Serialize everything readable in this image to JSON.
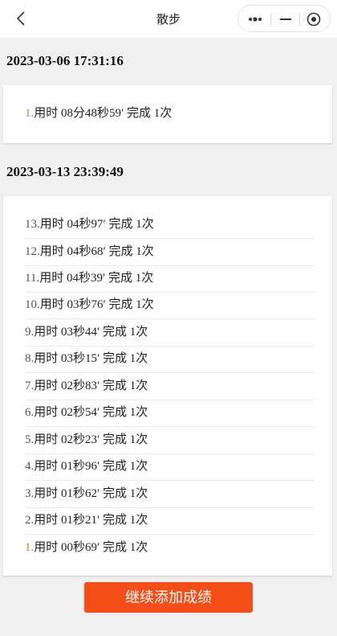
{
  "nav": {
    "title": "散步",
    "icons": [
      "back-icon",
      "more-icon",
      "minimize-icon",
      "target-icon"
    ]
  },
  "sessions": [
    {
      "date": "2023-03-06 17:31:16",
      "records": [
        {
          "index": "1.",
          "text": "用时 08分48秒59′ 完成 1次"
        }
      ]
    },
    {
      "date": "2023-03-13 23:39:49",
      "records": [
        {
          "index": "13.",
          "text": "用时 04秒97′ 完成 1次"
        },
        {
          "index": "12.",
          "text": "用时 04秒68′ 完成 1次"
        },
        {
          "index": "11.",
          "text": "用时 04秒39′ 完成 1次"
        },
        {
          "index": "10.",
          "text": "用时 03秒76′ 完成 1次"
        },
        {
          "index": "9.",
          "text": "用时 03秒44′ 完成 1次"
        },
        {
          "index": "8.",
          "text": "用时 03秒15′ 完成 1次"
        },
        {
          "index": "7.",
          "text": "用时 02秒83′ 完成 1次"
        },
        {
          "index": "6.",
          "text": "用时 02秒54′ 完成 1次"
        },
        {
          "index": "5.",
          "text": "用时 02秒23′ 完成 1次"
        },
        {
          "index": "4.",
          "text": "用时 01秒96′ 完成 1次"
        },
        {
          "index": "3.",
          "text": "用时 01秒62′ 完成 1次"
        },
        {
          "index": "2.",
          "text": "用时 01秒21′ 完成 1次"
        },
        {
          "index": "1.",
          "text": "用时 00秒69′ 完成 1次"
        }
      ]
    }
  ],
  "footer": {
    "continue_label": "继续添加成绩"
  },
  "colors": {
    "accent": "#f44d18",
    "first_index": "#c8862e",
    "background": "#f0f0f0"
  }
}
